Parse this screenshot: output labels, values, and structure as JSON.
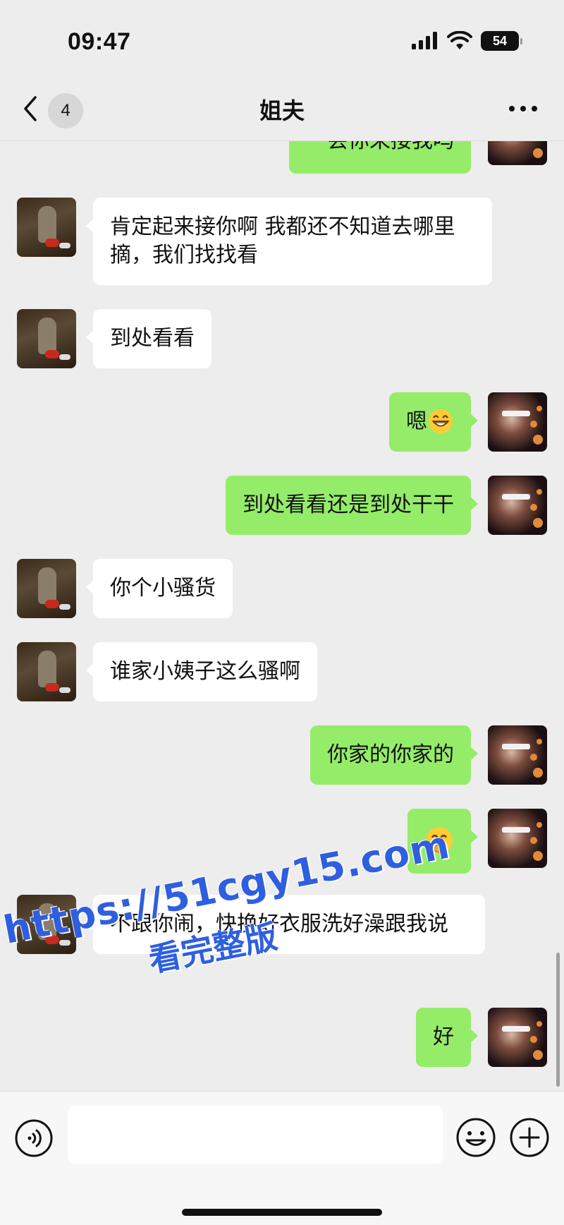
{
  "status_bar": {
    "time": "09:47",
    "battery": "54"
  },
  "nav": {
    "unread_count": "4",
    "title": "姐夫"
  },
  "messages": [
    {
      "side": "right",
      "text": "一会你来接我吗"
    },
    {
      "side": "left",
      "text": "肯定起来接你啊 我都还不知道去哪里摘，我们找找看"
    },
    {
      "side": "left",
      "text": "到处看看"
    },
    {
      "side": "right",
      "text": "嗯",
      "emoji": "grinning-face-emoji"
    },
    {
      "side": "right",
      "text": "到处看看还是到处干干"
    },
    {
      "side": "left",
      "text": "你个小骚货"
    },
    {
      "side": "left",
      "text": "谁家小姨子这么骚啊"
    },
    {
      "side": "right",
      "text": "你家的你家的"
    },
    {
      "side": "right",
      "text": "",
      "emoji": "shushing-face-emoji"
    },
    {
      "side": "left",
      "text": "不跟你闹，快换好衣服洗好澡跟我说"
    },
    {
      "side": "right",
      "text": "好"
    }
  ],
  "watermark": {
    "line1": "https://51cgy15.com",
    "line2": "看完整版"
  },
  "input": {
    "placeholder": "",
    "value": ""
  },
  "colors": {
    "background": "#ededed",
    "my_bubble": "#95ec69",
    "their_bubble": "#ffffff",
    "watermark": "#2f5fe0"
  }
}
